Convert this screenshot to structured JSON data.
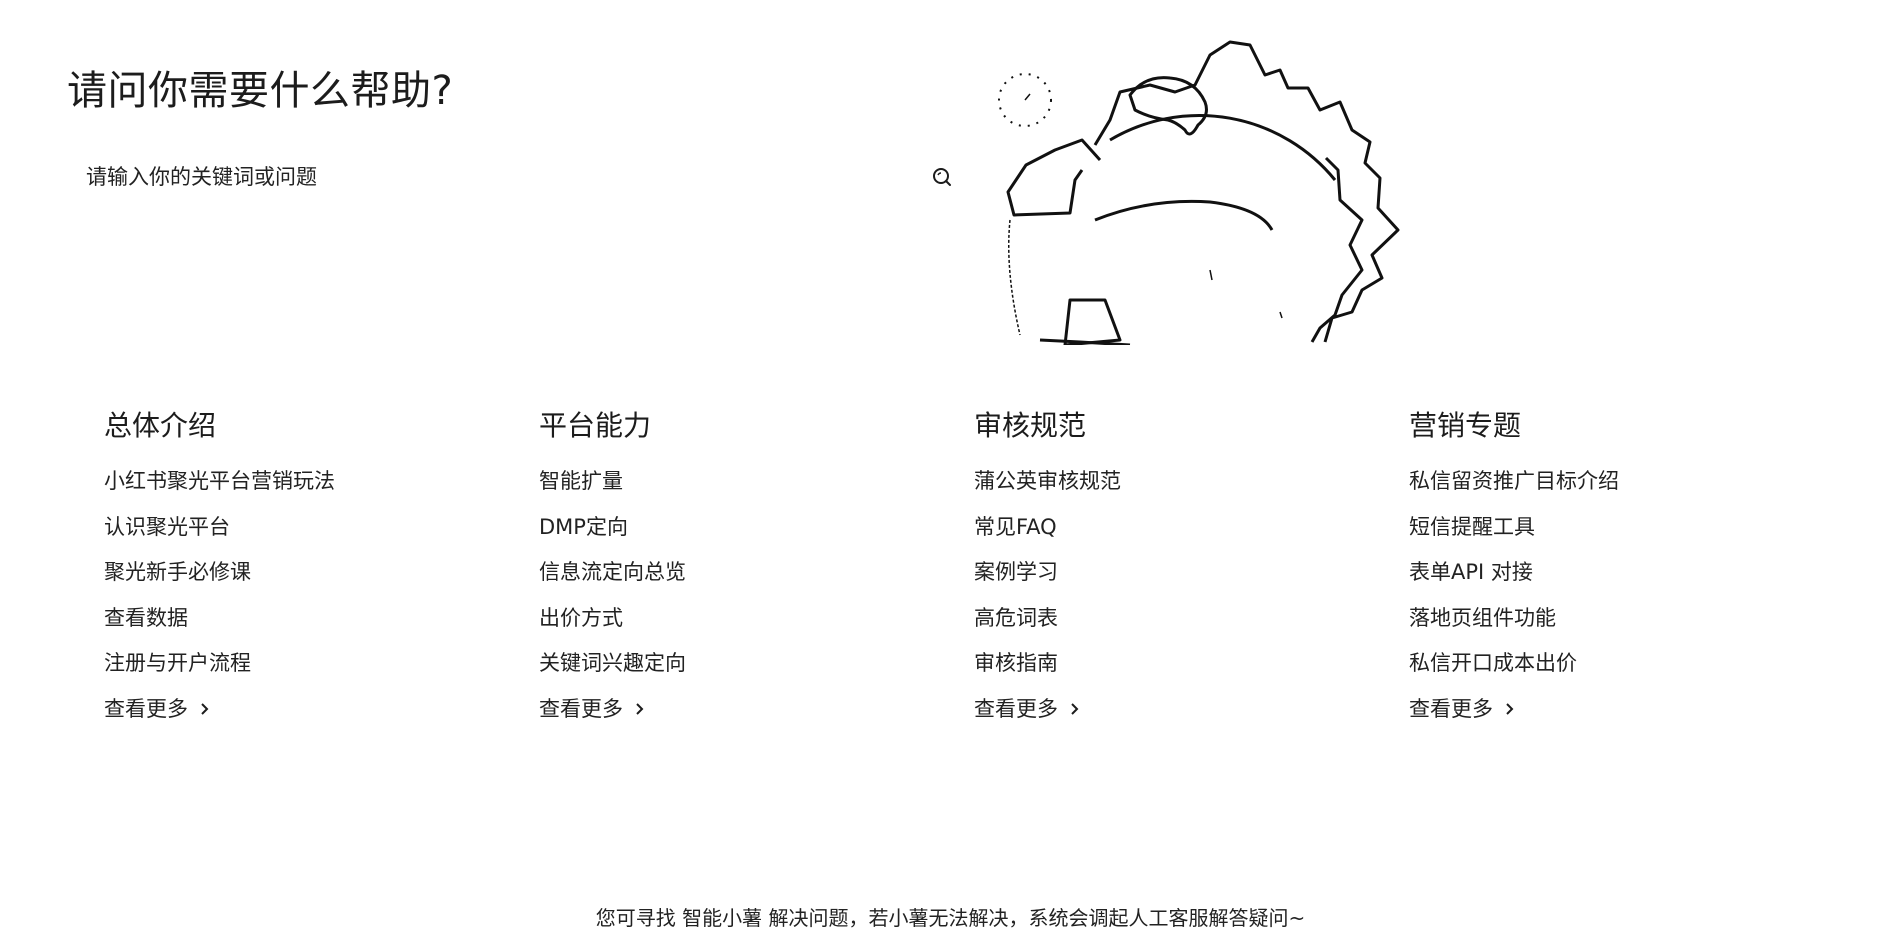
{
  "header": {
    "title": "请问你需要什么帮助?"
  },
  "search": {
    "placeholder": "请输入你的关键词或问题",
    "icon": "search-icon"
  },
  "categories": [
    {
      "title": "总体介绍",
      "items": [
        "小红书聚光平台营销玩法",
        "认识聚光平台",
        "聚光新手必修课",
        "查看数据",
        "注册与开户流程"
      ],
      "more_label": "查看更多"
    },
    {
      "title": "平台能力",
      "items": [
        "智能扩量",
        "DMP定向",
        "信息流定向总览",
        "出价方式",
        "关键词兴趣定向"
      ],
      "more_label": "查看更多"
    },
    {
      "title": "审核规范",
      "items": [
        "蒲公英审核规范",
        "常见FAQ",
        "案例学习",
        "高危词表",
        "审核指南"
      ],
      "more_label": "查看更多"
    },
    {
      "title": "营销专题",
      "items": [
        "私信留资推广目标介绍",
        "短信提醒工具",
        "表单API 对接",
        "落地页组件功能",
        "私信开口成本出价"
      ],
      "more_label": "查看更多"
    }
  ],
  "footer": {
    "note": "您可寻找 智能小薯 解决问题，若小薯无法解决，系统会调起人工客服解答疑问~"
  },
  "colors": {
    "text": "#222222",
    "background": "#ffffff"
  }
}
